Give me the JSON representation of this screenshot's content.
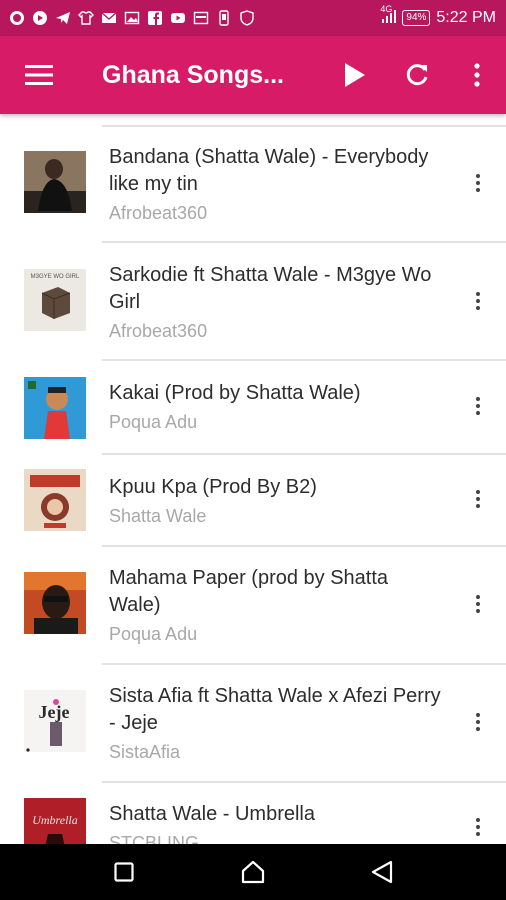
{
  "status_bar": {
    "time": "5:22 PM",
    "battery": "94%",
    "network": "4G",
    "notification_icons": [
      "whatsapp-icon",
      "youtube-icon",
      "telegram-icon",
      "shirt-icon",
      "mail-icon",
      "image-icon",
      "facebook-icon",
      "youtube-icon",
      "calendar-icon",
      "phone-icon",
      "shield-icon"
    ]
  },
  "app_bar": {
    "title": "Ghana Songs...",
    "menu_icon": "hamburger-icon",
    "play_icon": "play-icon",
    "refresh_icon": "refresh-icon",
    "overflow_icon": "more-vert-icon"
  },
  "songs": [
    {
      "title": "Bandana (Shatta Wale) - Everybody like my tin",
      "artist": "Afrobeat360",
      "thumb_color": "#5a4a3c"
    },
    {
      "title": "Sarkodie ft Shatta Wale - M3gye Wo Girl",
      "artist": "Afrobeat360",
      "thumb_color": "#e8e4de"
    },
    {
      "title": "Kakai (Prod by Shatta Wale)",
      "artist": "Poqua Adu",
      "thumb_color": "#3aa3d8"
    },
    {
      "title": "Kpuu Kpa (Prod By B2)",
      "artist": "Shatta Wale",
      "thumb_color": "#e9d7c2"
    },
    {
      "title": "Mahama Paper (prod by Shatta Wale)",
      "artist": "Poqua Adu",
      "thumb_color": "#b84a2a"
    },
    {
      "title": "Sista Afia ft Shatta Wale x Afezi Perry -  Jeje",
      "artist": "SistaAfia",
      "thumb_color": "#f4f1f1"
    },
    {
      "title": "Shatta Wale - Umbrella",
      "artist": "STCBLING",
      "thumb_color": "#b4202a"
    }
  ],
  "nav_bar": {
    "recents_icon": "square-icon",
    "home_icon": "home-icon",
    "back_icon": "back-triangle-icon"
  }
}
